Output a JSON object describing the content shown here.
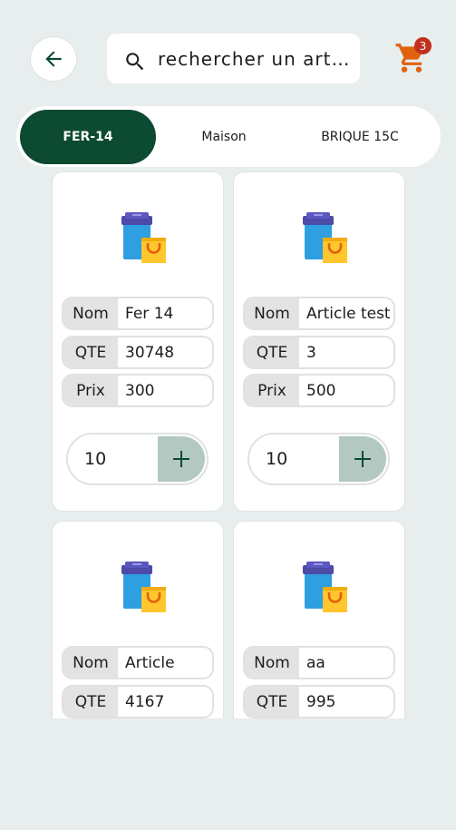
{
  "header": {
    "back_icon": "arrow-left-icon",
    "search": {
      "value": "rechercher un article",
      "icon": "search-icon"
    },
    "cart": {
      "icon": "cart-icon",
      "count": "3",
      "color": "#e0620f",
      "badge_color": "#c12f1f"
    }
  },
  "tabs": [
    {
      "label": "FER-14",
      "active": true
    },
    {
      "label": "Maison",
      "active": false
    },
    {
      "label": "BRIQUE 15C",
      "active": false
    }
  ],
  "accent": "#0c4a32",
  "labels": {
    "nom": "Nom",
    "qte": "QTE",
    "prix": "Prix"
  },
  "products": [
    {
      "nom": "Fer 14",
      "qte": "30748",
      "prix": "300",
      "quantity": "10",
      "image_icon": "shopping-bag-icon"
    },
    {
      "nom": "Article test",
      "qte": "3",
      "prix": "500",
      "quantity": "10",
      "image_icon": "shopping-bag-icon"
    },
    {
      "nom": "Article",
      "qte": "4167",
      "image_icon": "shopping-bag-icon"
    },
    {
      "nom": "aa",
      "qte": "995",
      "image_icon": "shopping-bag-icon"
    }
  ]
}
